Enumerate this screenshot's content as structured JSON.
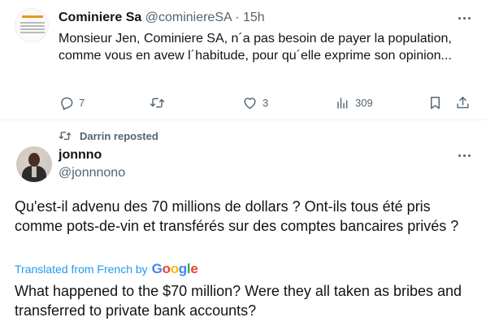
{
  "tweet1": {
    "author_name": "Cominiere Sa",
    "author_handle": "@cominiereSA",
    "separator": " · ",
    "time": "15h",
    "text": "Monsieur  Jen, Cominiere SA,  n´a pas besoin de payer la population, comme vous en avew l´habitude,  pour qu´elle exprime  son opinion...",
    "actions": {
      "reply_count": "7",
      "retweet_count": "",
      "like_count": "3",
      "views_count": "309"
    }
  },
  "repost_note": "Darrin reposted",
  "tweet2": {
    "author_name": "jonnno",
    "author_handle": "@jonnnono",
    "text": "Qu'est-il advenu des 70 millions de dollars ? Ont-ils tous été pris comme pots-de-vin et transférés sur des comptes bancaires privés ?",
    "translated_label": "Translated from French by",
    "translator_brand": [
      "G",
      "o",
      "o",
      "g",
      "l",
      "e"
    ],
    "translation": "What happened to the $70 million? Were they all taken as bribes and transferred to private bank accounts?"
  },
  "colors": {
    "text": "#0f1419",
    "muted": "#536471",
    "link": "#1d9bf0",
    "logo_accent": "#e8961e"
  },
  "icons": [
    "more-icon",
    "reply-icon",
    "retweet-icon",
    "like-icon",
    "views-icon",
    "bookmark-icon",
    "share-icon",
    "repost-icon"
  ]
}
